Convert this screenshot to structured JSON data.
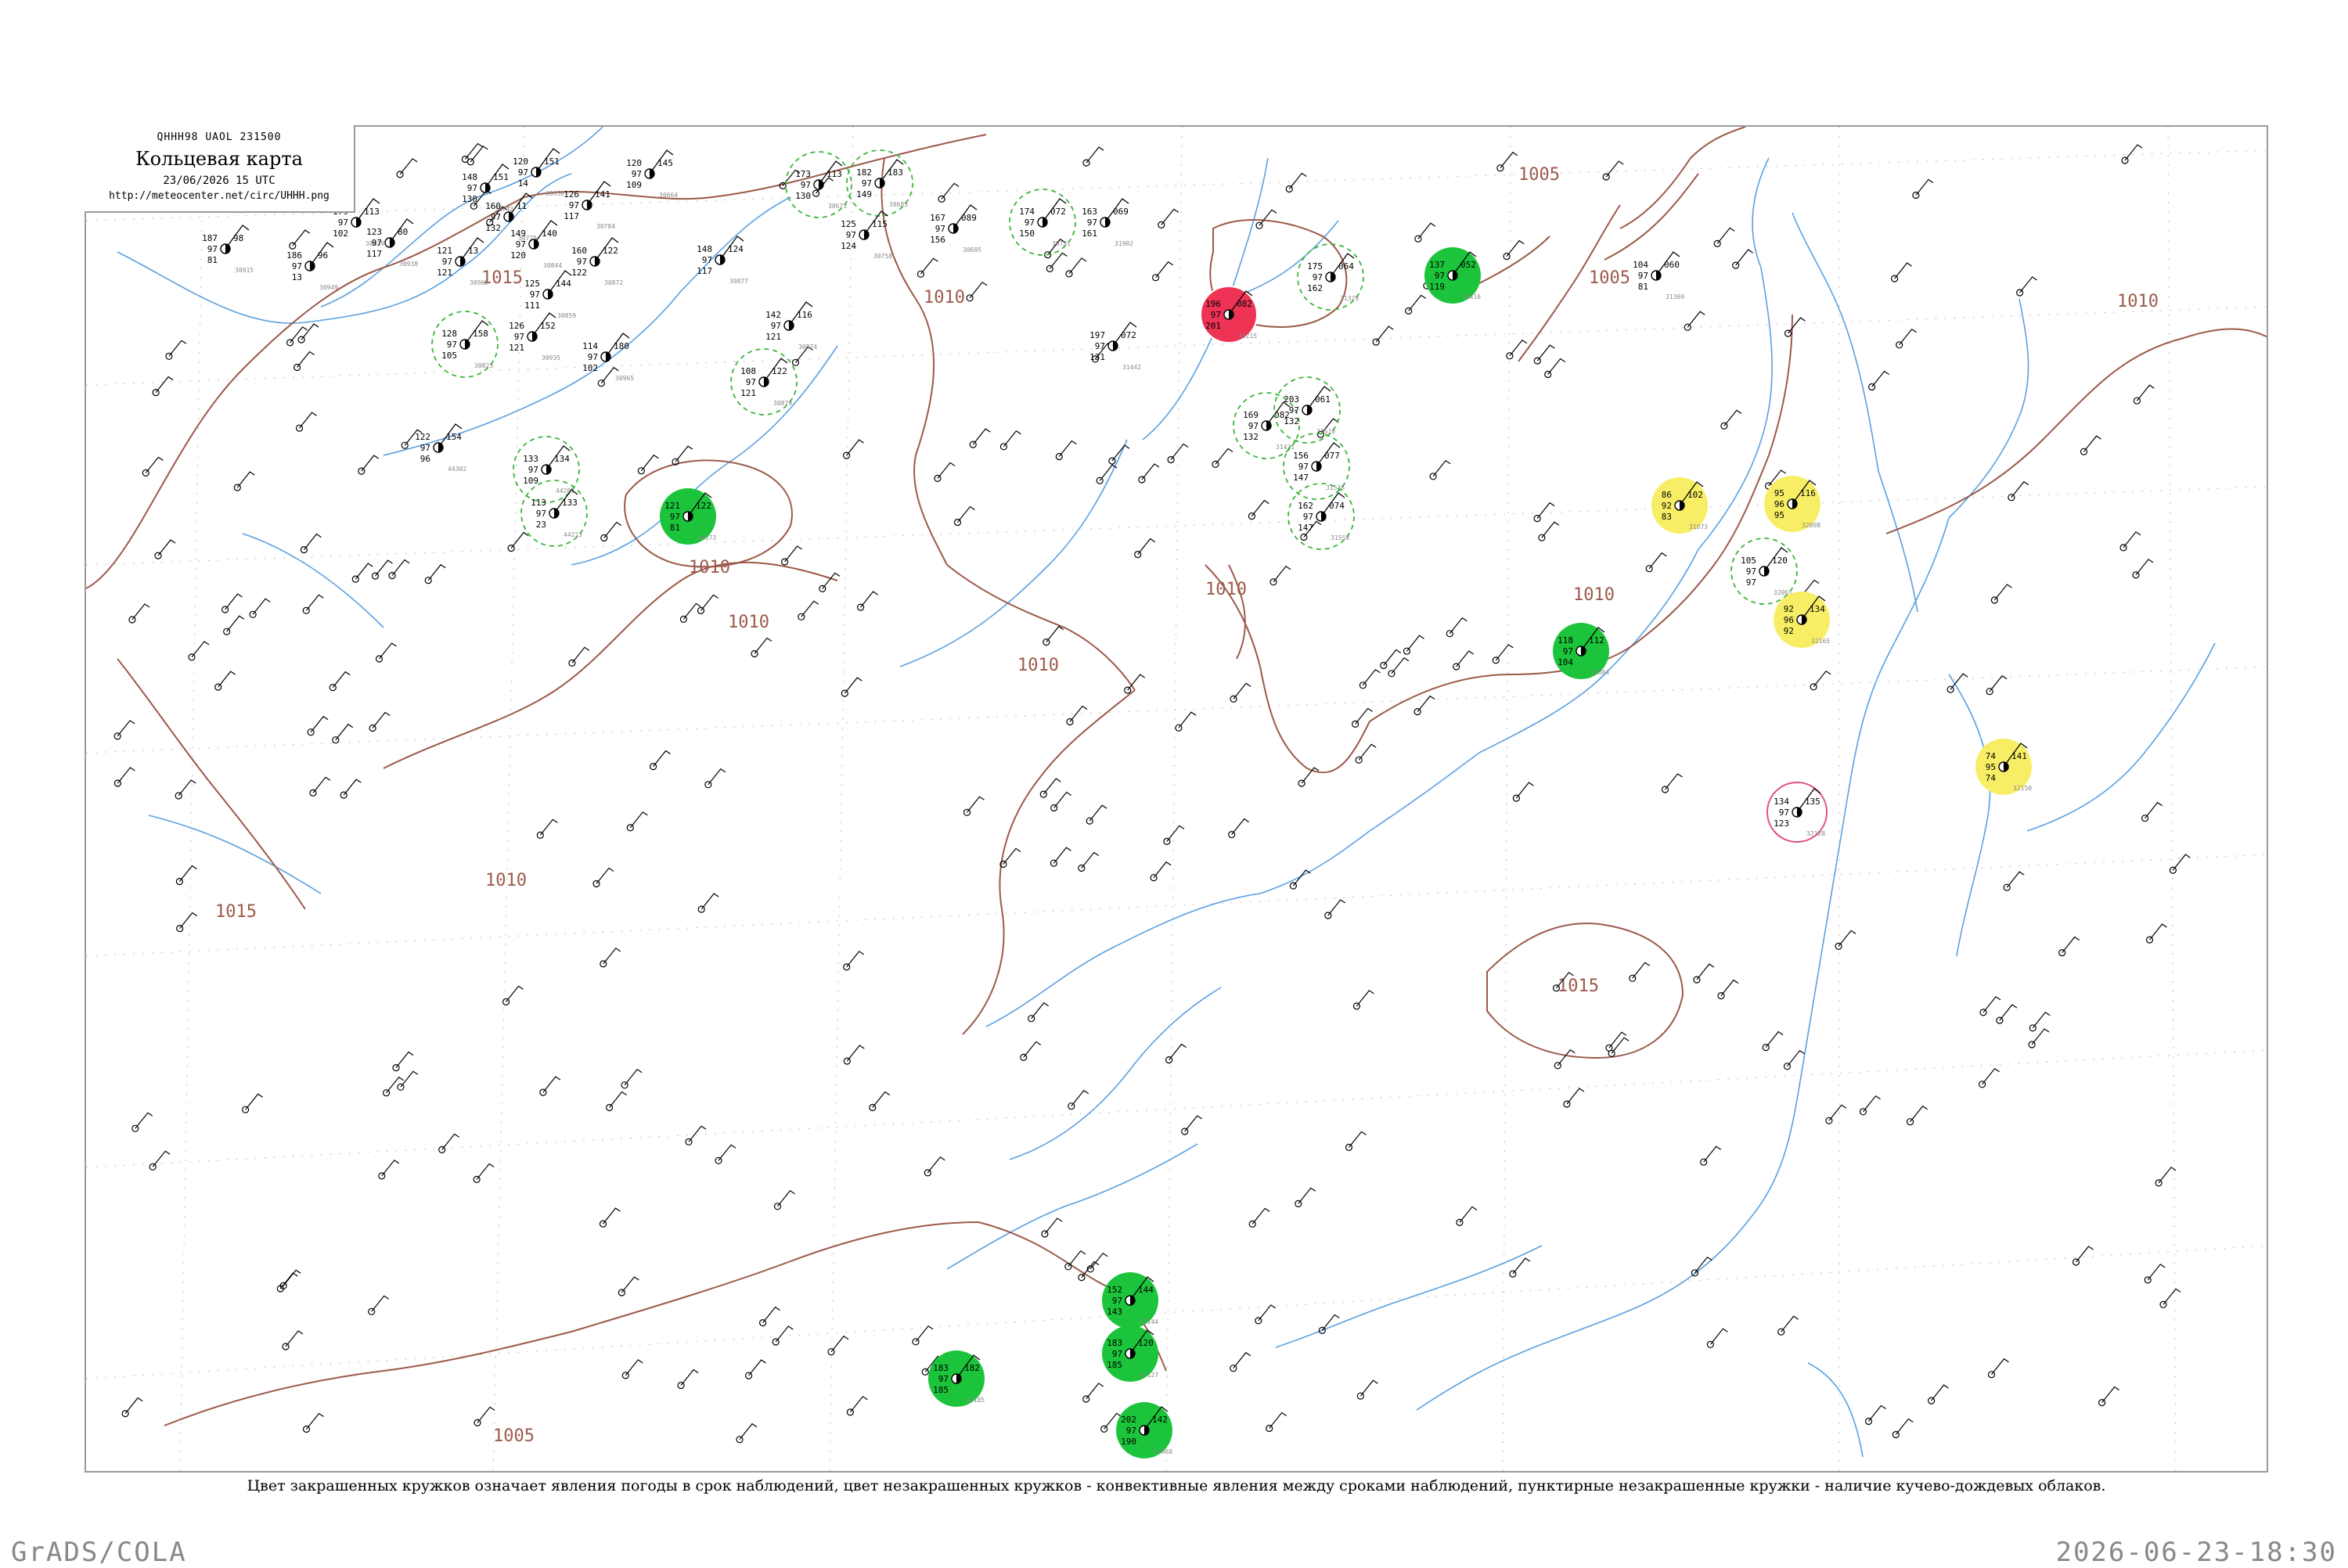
{
  "header": {
    "bulletin": "QHHH98  UAOL  231500",
    "title": "Кольцевая карта",
    "datetime": "23/06/2026 15 UTC",
    "url": "http://meteocenter.net/circ/UHHH.png"
  },
  "caption": "Цвет закрашенных кружков означает явления погоды в срок наблюдений, цвет незакрашенных кружков - конвективные явления между сроками наблюдений, пунктирные незакрашенные кружки - наличие кучево-дождевых облаков.",
  "footer": {
    "left": "GrADS/COLA",
    "right": "2026-06-23-18:30"
  },
  "colors": {
    "isobar": "#9c5a4a",
    "river": "#5aa0e0",
    "grid": "#c8c8c8",
    "storm_green": "#1bc43a",
    "fog_yellow": "#f7ee66",
    "hail_red": "#ee3355",
    "cb_dashed": "#3ab53a",
    "convective_pink": "#e0507a"
  },
  "isobars": [
    {
      "label": "1015"
    },
    {
      "label": "1010"
    },
    {
      "label": "1010"
    },
    {
      "label": "1010"
    },
    {
      "label": "1010"
    },
    {
      "label": "1010"
    },
    {
      "label": "1010"
    },
    {
      "label": "1010"
    },
    {
      "label": "1005"
    },
    {
      "label": "1005"
    },
    {
      "label": "1010"
    },
    {
      "label": "1015"
    },
    {
      "label": "1015"
    },
    {
      "label": "1005"
    }
  ],
  "stations": [
    {
      "p": "148",
      "t": "97",
      "d": "130",
      "c": "151",
      "id": "30742",
      "sym": "none"
    },
    {
      "p": "160",
      "t": "97",
      "d": "132",
      "c": "11",
      "id": "30725",
      "sym": "none"
    },
    {
      "p": "120",
      "t": "97",
      "d": "14",
      "c": "151",
      "id": "30650",
      "sym": "none"
    },
    {
      "p": "120",
      "t": "97",
      "d": "109",
      "c": "145",
      "id": "30664",
      "sym": "none"
    },
    {
      "p": "179",
      "t": "97",
      "d": "102",
      "c": "113",
      "id": "30829",
      "sym": "none"
    },
    {
      "p": "187",
      "t": "97",
      "d": "81",
      "c": "98",
      "id": "30915",
      "sym": "none"
    },
    {
      "p": "123",
      "t": "97",
      "d": "117",
      "c": "80",
      "id": "30938",
      "sym": "none"
    },
    {
      "p": "186",
      "t": "97",
      "d": "13",
      "c": "96",
      "id": "30949",
      "sym": "none"
    },
    {
      "p": "121",
      "t": "97",
      "d": "121",
      "c": "13",
      "id": "30965",
      "sym": "none"
    },
    {
      "p": "149",
      "t": "97",
      "d": "120",
      "c": "140",
      "id": "30844",
      "sym": "none"
    },
    {
      "p": "126",
      "t": "97",
      "d": "117",
      "c": "141",
      "id": "30784",
      "sym": "none"
    },
    {
      "p": "160",
      "t": "97",
      "d": "122",
      "c": "122",
      "id": "30872",
      "sym": "none"
    },
    {
      "p": "148",
      "t": "97",
      "d": "117",
      "c": "124",
      "id": "30877",
      "sym": "none"
    },
    {
      "p": "173",
      "t": "97",
      "d": "130",
      "c": "113",
      "id": "30673",
      "sym": "cb"
    },
    {
      "p": "182",
      "t": "97",
      "d": "149",
      "c": "183",
      "id": "30685",
      "sym": "cb"
    },
    {
      "p": "125",
      "t": "97",
      "d": "124",
      "c": "115",
      "id": "30758",
      "sym": "none"
    },
    {
      "p": "167",
      "t": "97",
      "d": "156",
      "c": "089",
      "id": "30695",
      "sym": "none"
    },
    {
      "p": "174",
      "t": "97",
      "d": "150",
      "c": "072",
      "id": "30781",
      "sym": "cb"
    },
    {
      "p": "163",
      "t": "97",
      "d": "161",
      "c": "069",
      "id": "31902",
      "sym": "none"
    },
    {
      "p": "196",
      "t": "97",
      "d": "201",
      "c": "082",
      "id": "31215",
      "sym": "hail"
    },
    {
      "p": "175",
      "t": "97",
      "d": "162",
      "c": "064",
      "id": "31329",
      "sym": "cb"
    },
    {
      "p": "137",
      "t": "97",
      "d": "119",
      "c": "052",
      "id": "31416",
      "sym": "storm"
    },
    {
      "p": "104",
      "t": "97",
      "d": "81",
      "c": "060",
      "id": "31369",
      "sym": "none"
    },
    {
      "p": "128",
      "t": "97",
      "d": "105",
      "c": "158",
      "id": "30823",
      "sym": "cb"
    },
    {
      "p": "126",
      "t": "97",
      "d": "121",
      "c": "152",
      "id": "30935",
      "sym": "none"
    },
    {
      "p": "125",
      "t": "97",
      "d": "111",
      "c": "144",
      "id": "30859",
      "sym": "none"
    },
    {
      "p": "114",
      "t": "97",
      "d": "102",
      "c": "180",
      "id": "30965",
      "sym": "none"
    },
    {
      "p": "108",
      "t": "97",
      "d": "121",
      "c": "122",
      "id": "30879",
      "sym": "cb"
    },
    {
      "p": "142",
      "t": "97",
      "d": "121",
      "c": "116",
      "id": "30874",
      "sym": "none"
    },
    {
      "p": "197",
      "t": "97",
      "d": "131",
      "c": "072",
      "id": "31442",
      "sym": "none"
    },
    {
      "p": "133",
      "t": "97",
      "d": "109",
      "c": "134",
      "id": "44203",
      "sym": "cb"
    },
    {
      "p": "113",
      "t": "97",
      "d": "23",
      "c": "133",
      "id": "44213",
      "sym": "cb"
    },
    {
      "p": "122",
      "t": "97",
      "d": "96",
      "c": "154",
      "id": "44302",
      "sym": "none"
    },
    {
      "p": "121",
      "t": "97",
      "d": "81",
      "c": "122",
      "id": "44373",
      "sym": "storm"
    },
    {
      "p": "169",
      "t": "97",
      "d": "132",
      "c": "082",
      "id": "31421",
      "sym": "cb"
    },
    {
      "p": "203",
      "t": "97",
      "d": "132",
      "c": "061",
      "id": "31510",
      "sym": "cb"
    },
    {
      "p": "156",
      "t": "97",
      "d": "147",
      "c": "077",
      "id": "31538",
      "sym": "cb"
    },
    {
      "p": "162",
      "t": "97",
      "d": "147",
      "c": "074",
      "id": "31558",
      "sym": "cb"
    },
    {
      "p": "86",
      "t": "92",
      "d": "83",
      "c": "102",
      "id": "31873",
      "sym": "fog"
    },
    {
      "p": "95",
      "t": "96",
      "d": "95",
      "c": "116",
      "id": "32098",
      "sym": "fog"
    },
    {
      "p": "105",
      "t": "97",
      "d": "97",
      "c": "120",
      "id": "32061",
      "sym": "cb"
    },
    {
      "p": "92",
      "t": "96",
      "d": "92",
      "c": "134",
      "id": "32165",
      "sym": "fog"
    },
    {
      "p": "118",
      "t": "97",
      "d": "104",
      "c": "112",
      "id": "31884",
      "sym": "storm"
    },
    {
      "p": "74",
      "t": "95",
      "d": "74",
      "c": "141",
      "id": "32150",
      "sym": "fog"
    },
    {
      "p": "134",
      "t": "97",
      "d": "123",
      "c": "135",
      "id": "32128",
      "sym": "convective"
    },
    {
      "p": "152",
      "t": "97",
      "d": "143",
      "c": "144",
      "id": "47144",
      "sym": "storm"
    },
    {
      "p": "183",
      "t": "97",
      "d": "185",
      "c": "120",
      "id": "47127",
      "sym": "storm"
    },
    {
      "p": "183",
      "t": "97",
      "d": "185",
      "c": "182",
      "id": "47185",
      "sym": "storm"
    },
    {
      "p": "202",
      "t": "97",
      "d": "190",
      "c": "142",
      "id": "47868",
      "sym": "storm"
    }
  ]
}
